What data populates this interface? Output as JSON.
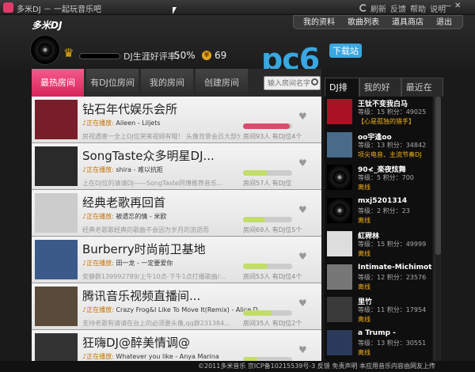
{
  "window": {
    "title": "多米DJ － 一起玩音乐吧",
    "links": [
      "刷新",
      "反馈",
      "帮助",
      "说明"
    ]
  },
  "header": {
    "logo": "多米DJ",
    "nav": [
      "我的资料",
      "歌曲列表",
      "道具商店",
      "退出"
    ],
    "rating_label": "DJ生涯好评率:",
    "rating_value": "50%",
    "coins": "69",
    "rating_level": 0.9
  },
  "watermark": {
    "text": "pc6",
    "badge": "下载站"
  },
  "tabs": [
    {
      "label": "最热房间",
      "active": true
    },
    {
      "label": "有DJ位房间"
    },
    {
      "label": "我的房间"
    },
    {
      "label": "创建房间"
    }
  ],
  "search": {
    "placeholder": "输入房间名字"
  },
  "right_tabs": [
    {
      "label": "DJ排行",
      "active": true
    },
    {
      "label": "我的好友"
    },
    {
      "label": "最近在线"
    }
  ],
  "rooms": [
    {
      "title": "钻石年代娱乐会所",
      "playing_label": "正在播放:",
      "track": "Aileen - Liljets",
      "desc": "房视遇害一全上DJ位哭来视频有哦！ 头像背景会员大部分人...",
      "listeners": "房间93人",
      "dj": "有DJ位4个",
      "heat": 0.95
    },
    {
      "title": "SongTaste众多明星DJ...",
      "playing_label": "正在播放:",
      "track": "shira - 难以抗拒",
      "desc": "上在DJ位的请请DJ——SongTaste同博推荐音乐...",
      "listeners": "房间57人",
      "dj": "有DJ位",
      "heat": 0.5
    },
    {
      "title": "经典老歌再回首",
      "playing_label": "正在播放:",
      "track": "被遗忘的情 - 米欧",
      "desc": "经典老歌歌经典的歌曲不会因为岁月的流逝而",
      "listeners": "房间69人",
      "dj": "有DJ位5个",
      "heat": 0.45
    },
    {
      "title": "Burberry时尚前卫基地",
      "playing_label": "正在播放:",
      "track": "田一龙 - 一定要爱你",
      "desc": "安静群139992789/上午10点-下午1点打播歌曲/...",
      "listeners": "房间53人",
      "dj": "有DJ位4个",
      "heat": 0.5
    },
    {
      "title": "腾讯音乐视频直播间...",
      "playing_label": "正在播放:",
      "track": "Crazy Frog&I Like To Move It(Remix) - Alice D",
      "desc": "支持老歌有请请在台上的必须要头像,qq群231384...",
      "listeners": "房间35人",
      "dj": "有DJ位2个",
      "heat": 0.6
    },
    {
      "title": "狂嗨DJ@醉美情调@",
      "playing_label": "正在播放:",
      "track": "Whatever you like - Anya Marina",
      "desc": "",
      "listeners": "",
      "dj": "",
      "heat": 0.3
    }
  ],
  "ranking": [
    {
      "name": "王钛不变我白马",
      "level": "等级：15 积分：49025",
      "status": "【心是孤独的猎手】"
    },
    {
      "name": "oo宇逢oo",
      "level": "等级：13 积分：34842",
      "status": "项尖电音、主流节奏DJ"
    },
    {
      "name": "90≮_楽夜炫舞",
      "level": "等级：5 积分：700",
      "status": "离线"
    },
    {
      "name": "mxj5201314",
      "level": "等级：2 积分：23",
      "status": "离线"
    },
    {
      "name": "紅稈林",
      "level": "等级：15 积分：49999",
      "status": "离线"
    },
    {
      "name": "Intimate-Michimoto",
      "level": "等级：12 积分：23576",
      "status": "离线"
    },
    {
      "name": "里竹",
      "level": "等级：11 积分：17954",
      "status": "离线"
    },
    {
      "name": "a Trump -",
      "level": "等级：13 积分：30551",
      "status": "离线"
    }
  ],
  "footer": {
    "text": "©2011多米音乐   京ICP备10215539号-3 反馈 免责声明 本应用音乐内容由网友上传"
  }
}
